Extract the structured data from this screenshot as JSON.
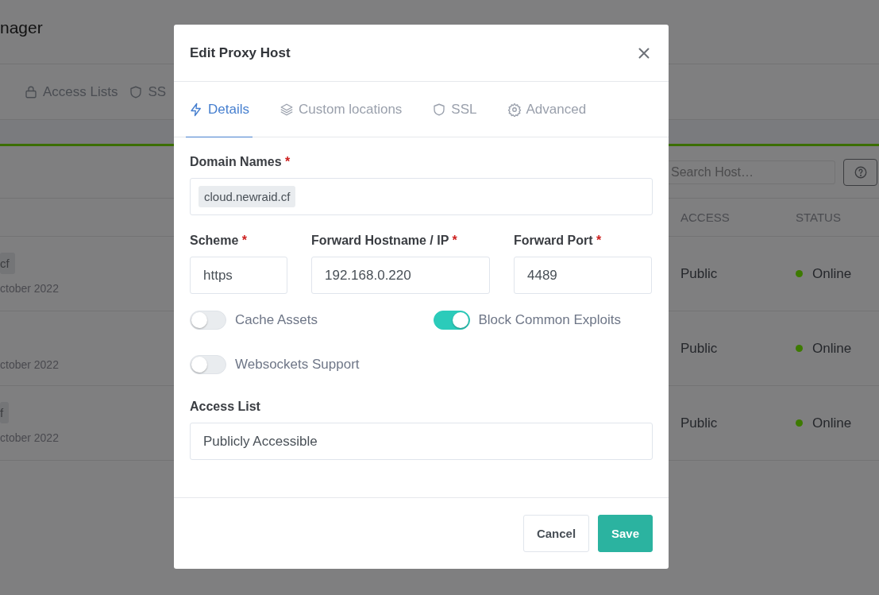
{
  "background": {
    "app_title": "nager",
    "nav": [
      {
        "label": "Access Lists"
      },
      {
        "label": "SS"
      }
    ],
    "search": {
      "placeholder": "Search Host…"
    },
    "table": {
      "columns": [
        "ACCESS",
        "STATUS"
      ],
      "rows": [
        {
          "badge": "cf",
          "date": "ctober 2022",
          "access": "Public",
          "status": "Online"
        },
        {
          "date": "ctober 2022",
          "access": "Public",
          "status": "Online"
        },
        {
          "badge": "f",
          "date": "ctober 2022",
          "access": "Public",
          "status": "Online"
        }
      ]
    }
  },
  "modal": {
    "title": "Edit Proxy Host",
    "tabs": [
      {
        "label": "Details",
        "selected": true
      },
      {
        "label": "Custom locations",
        "selected": false
      },
      {
        "label": "SSL",
        "selected": false
      },
      {
        "label": "Advanced",
        "selected": false
      }
    ],
    "domain_names": {
      "label": "Domain Names",
      "required_mark": "*",
      "tags": [
        "cloud.newraid.cf"
      ]
    },
    "fields": [
      {
        "label": "Scheme",
        "required_mark": "*",
        "value": "https"
      },
      {
        "label": "Forward Hostname / IP",
        "required_mark": "*",
        "value": "192.168.0.220"
      },
      {
        "label": "Forward Port",
        "required_mark": "*",
        "value": "4489"
      }
    ],
    "toggles": [
      {
        "label": "Cache Assets",
        "on": false
      },
      {
        "label": "Block Common Exploits",
        "on": true
      },
      {
        "label": "Websockets Support",
        "on": false
      }
    ],
    "access_list": {
      "label": "Access List",
      "value": "Publicly Accessible"
    },
    "buttons": {
      "cancel": "Cancel",
      "save": "Save"
    }
  }
}
